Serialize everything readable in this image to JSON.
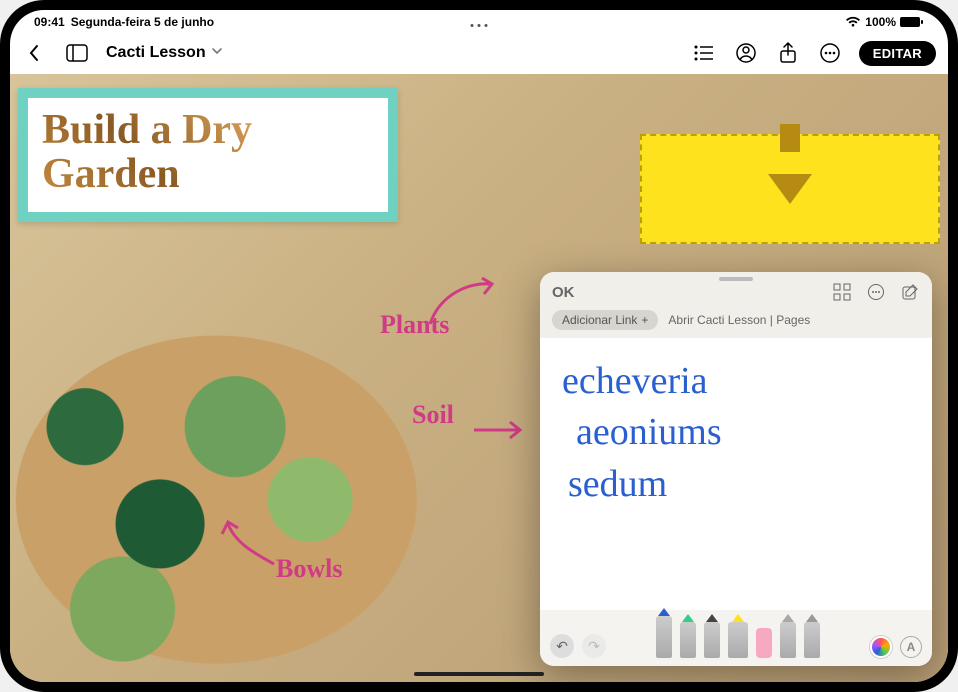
{
  "status": {
    "time": "09:41",
    "date": "Segunda-feira 5 de junho",
    "battery_pct": "100%"
  },
  "toolbar": {
    "doc_title": "Cacti Lesson",
    "edit_label": "EDITAR"
  },
  "canvas": {
    "title_line1": "Build a Dry",
    "title_line2": "Garden",
    "label_plants": "Plants",
    "label_soil": "Soil",
    "label_bowls": "Bowls"
  },
  "note": {
    "ok_label": "OK",
    "add_link_label": "Adicionar Link",
    "open_link_label": "Abrir Cacti Lesson | Pages",
    "lines": [
      "echeveria",
      "aeoniums",
      "sedum"
    ],
    "text_tool_glyph": "A"
  }
}
